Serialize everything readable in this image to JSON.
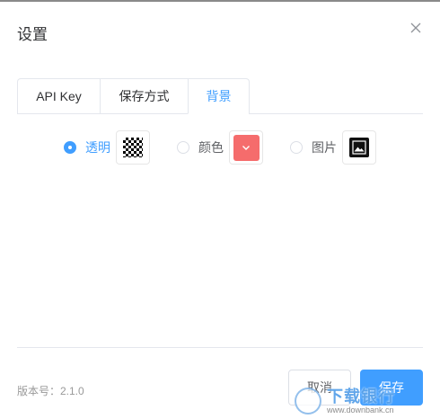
{
  "dialog": {
    "title": "设置",
    "close_icon": "close-icon"
  },
  "tabs": [
    {
      "label": "API Key",
      "active": false
    },
    {
      "label": "保存方式",
      "active": false
    },
    {
      "label": "背景",
      "active": true
    }
  ],
  "background": {
    "options": [
      {
        "label": "透明",
        "selected": true,
        "swatch_icon": "transparent-checker-icon"
      },
      {
        "label": "颜色",
        "selected": false,
        "swatch_icon": "chevron-down-icon",
        "color": "#f56c6c"
      },
      {
        "label": "图片",
        "selected": false,
        "swatch_icon": "image-icon"
      }
    ]
  },
  "footer": {
    "version": "版本号：2.1.0",
    "cancel_label": "取消",
    "save_label": "保存"
  },
  "watermark": {
    "main": "下载银行",
    "sub": "www.downbank.cn"
  },
  "colors": {
    "accent": "#409eff",
    "swatch_red": "#f56c6c",
    "border": "#e4e7ed"
  }
}
